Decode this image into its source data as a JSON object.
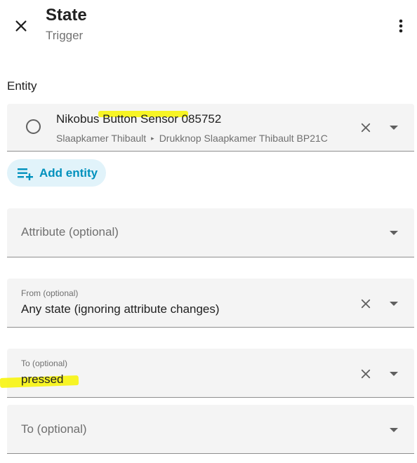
{
  "header": {
    "title": "State",
    "subtitle": "Trigger",
    "close_icon": "close-icon",
    "more_icon": "more-vertical-icon"
  },
  "entity_section": {
    "label": "Entity",
    "entity": {
      "name": "Nikobus Button Sensor 085752",
      "area": "Slaapkamer Thibault",
      "separator": "▸",
      "device": "Drukknop Slaapkamer Thibault BP21C"
    },
    "add_entity_label": "Add entity"
  },
  "fields": {
    "attribute": {
      "placeholder": "Attribute (optional)"
    },
    "from": {
      "label": "From (optional)",
      "value": "Any state (ignoring attribute changes)"
    },
    "to": {
      "label": "To (optional)",
      "value": "pressed"
    },
    "to_extra": {
      "placeholder": "To (optional)"
    }
  },
  "colors": {
    "accent": "#0091bd",
    "chip_background": "#e1f3fa",
    "field_background": "#f4f4f4",
    "highlight": "#f7f300"
  }
}
